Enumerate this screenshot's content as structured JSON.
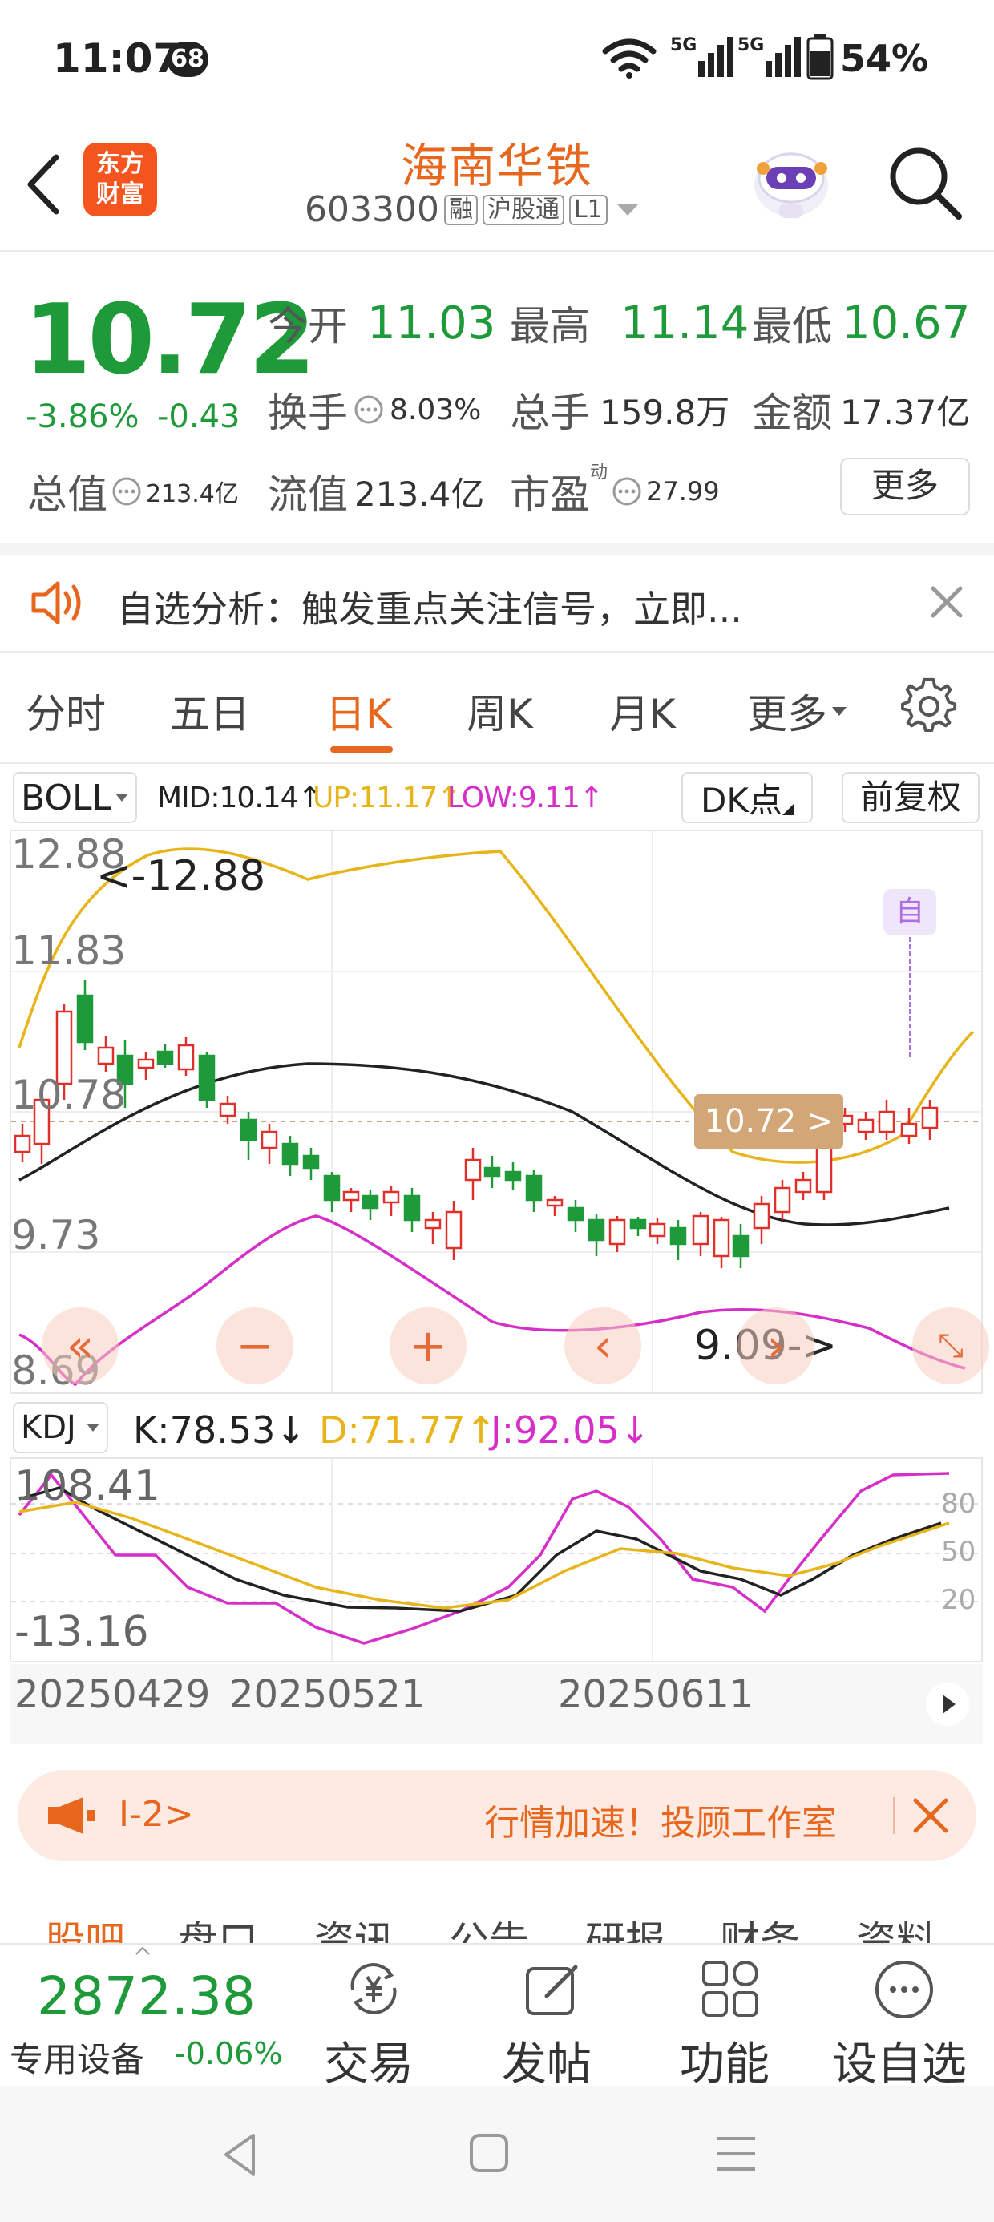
{
  "status_bar": {
    "time": "11:07",
    "notif_count": "68",
    "battery": "54%",
    "net1": "5G",
    "net2": "5G"
  },
  "header": {
    "title": "海南华铁",
    "code": "603300",
    "tags": [
      "融",
      "沪股通",
      "L1"
    ],
    "logo_text": [
      "东方",
      "财富"
    ]
  },
  "quote": {
    "price": "10.72",
    "change_pct": "-3.86%",
    "change_abs": "-0.43",
    "open_label": "今开",
    "open_value": "11.03",
    "high_label": "最高",
    "high_value": "11.14",
    "low_label": "最低",
    "low_value": "10.67",
    "turnover_label": "换手",
    "turnover_value": "8.03%",
    "volume_label": "总手",
    "volume_value": "159.8万",
    "amount_label": "金额",
    "amount_value": "17.37亿",
    "mcap_label": "总值",
    "mcap_value": "213.4亿",
    "float_label": "流值",
    "float_value": "213.4亿",
    "pe_label": "市盈",
    "pe_sup": "动",
    "pe_value": "27.99",
    "more_button": "更多"
  },
  "alert": {
    "text": "自选分析：触发重点关注信号，立即..."
  },
  "tabs": {
    "items": [
      "分时",
      "五日",
      "日K",
      "周K",
      "月K",
      "更多"
    ],
    "active": "日K"
  },
  "indicator_bar": {
    "name": "BOLL",
    "mid": "MID:10.14↑",
    "up": "UP:11.17↑",
    "low": "LOW:9.11↑",
    "dk_button": "DK点",
    "adjust_button": "前复权"
  },
  "main_chart": {
    "y_labels": [
      "12.88",
      "11.83",
      "10.78",
      "9.73",
      "8.69"
    ],
    "max_marker": "<-12.88",
    "min_marker": "9.09->",
    "current_price_tag": "10.72 >",
    "self_tag": "自"
  },
  "kdj_bar": {
    "name": "KDJ",
    "k": "K:78.53↓",
    "d": "D:71.77↑",
    "j": "J:92.05↓"
  },
  "kdj_chart": {
    "y_top": "108.41",
    "y_bottom": "-13.16",
    "levels": [
      "80",
      "50",
      "20"
    ]
  },
  "x_axis": {
    "dates": [
      "20250429",
      "20250521",
      "20250611"
    ]
  },
  "news_banner": {
    "left": "I-2>",
    "right": "行情加速！投顾工作室"
  },
  "bottom_tabs": [
    "股吧",
    "盘口",
    "资讯",
    "公告",
    "研报",
    "财务",
    "资料"
  ],
  "bottom_nav": {
    "index_value": "2872.38",
    "index_label": "专用设备",
    "index_change": "-0.06%",
    "items": [
      "交易",
      "发帖",
      "功能",
      "设自选"
    ]
  },
  "colors": {
    "up": "#e0302b",
    "down": "#1f9a3a",
    "accent": "#e7671f",
    "boll_up": "#e7b51a",
    "boll_low": "#d62ec8"
  }
}
